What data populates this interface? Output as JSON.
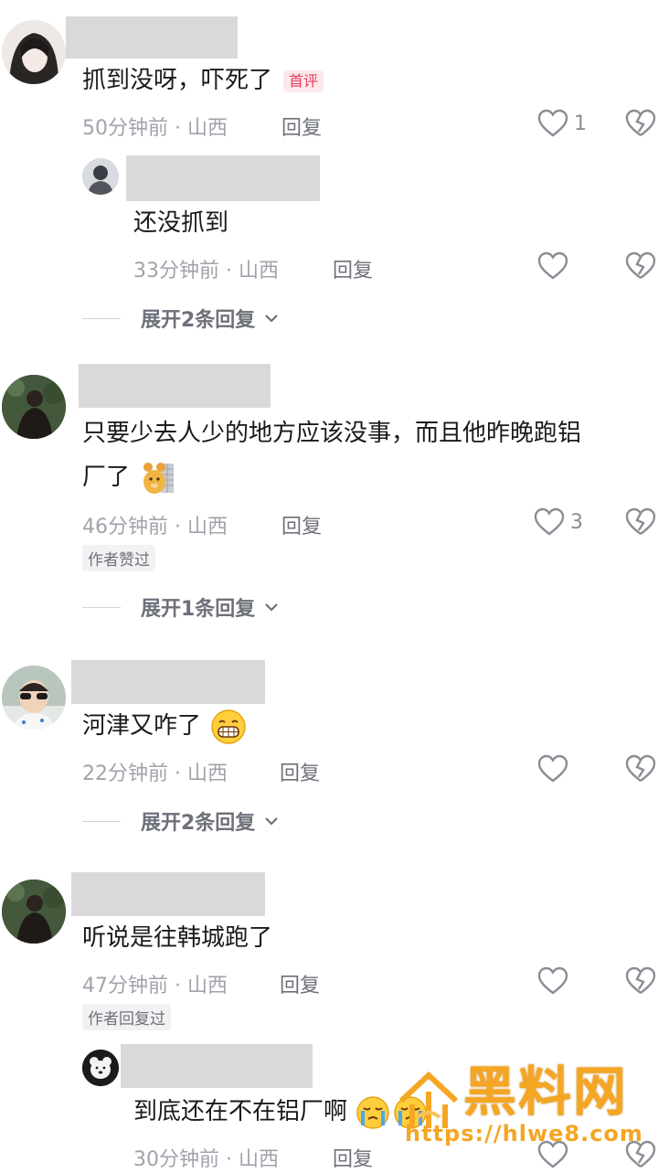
{
  "comments": [
    {
      "text": "抓到没呀，吓死了",
      "tag": "首评",
      "time": "50分钟前 · 山西",
      "reply_label": "回复",
      "likes": "1",
      "replies": [
        {
          "text": "还没抓到",
          "time": "33分钟前 · 山西",
          "reply_label": "回复"
        }
      ],
      "expand": "展开2条回复"
    },
    {
      "text_line1": "只要少去人少的地方应该没事，而且他昨晚跑铝",
      "text_line2": "厂了",
      "time": "46分钟前 · 山西",
      "reply_label": "回复",
      "likes": "3",
      "badge": "作者赞过",
      "expand": "展开1条回复"
    },
    {
      "text": "河津又咋了",
      "time": "22分钟前 · 山西",
      "reply_label": "回复",
      "expand": "展开2条回复"
    },
    {
      "text": "听说是往韩城跑了",
      "time": "47分钟前 · 山西",
      "reply_label": "回复",
      "badge": "作者回复过",
      "replies": [
        {
          "text": "到底还在不在铝厂啊",
          "time": "30分钟前 · 山西",
          "reply_label": "回复"
        }
      ]
    }
  ],
  "watermark": {
    "brand": "黑料网",
    "url": "https://hlwe8.com"
  },
  "icons": [
    "heart-icon",
    "broken-heart-icon",
    "chevron-down-icon"
  ]
}
